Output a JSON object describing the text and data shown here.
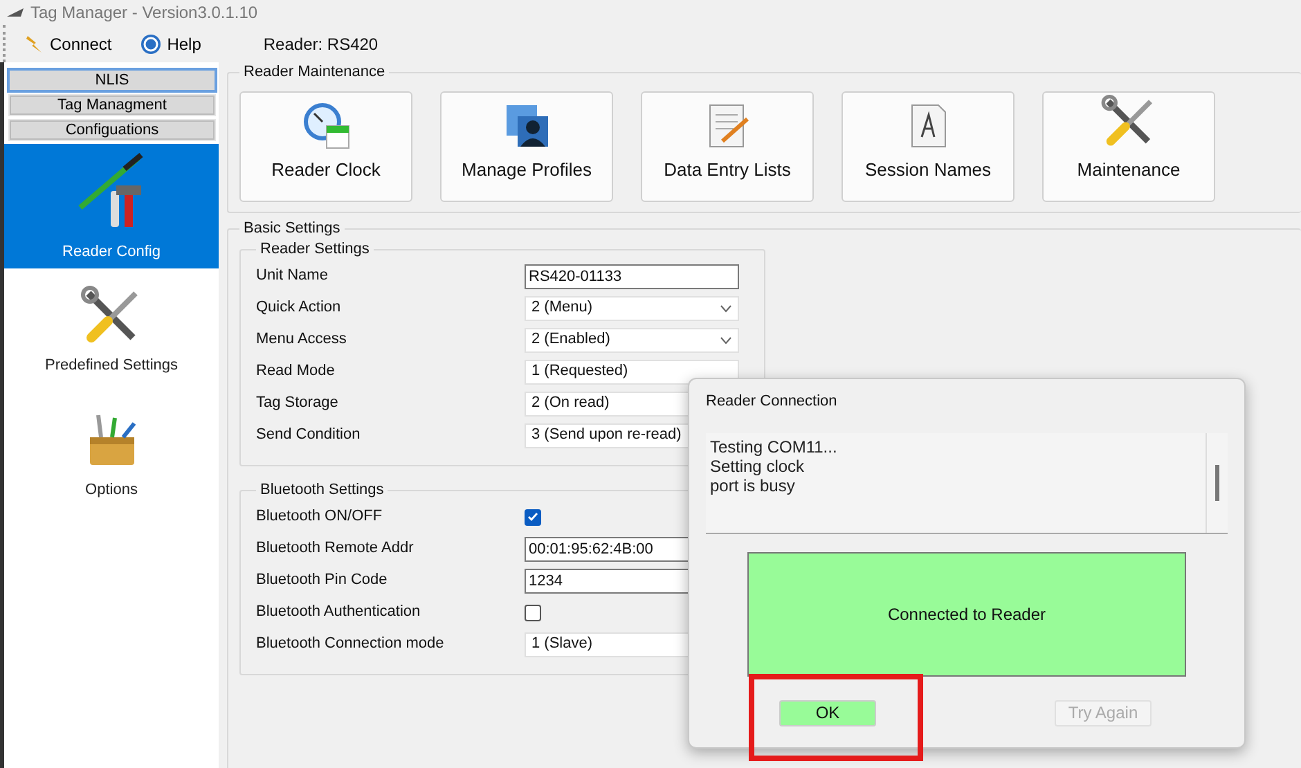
{
  "window": {
    "title": "Tag Manager - Version3.0.1.10"
  },
  "toolbar": {
    "buttons": [
      {
        "label": "Connect",
        "kind": "connect"
      },
      {
        "label": "Help",
        "kind": "help"
      }
    ],
    "reader": "Reader: RS420"
  },
  "sidebar": {
    "sections": [
      {
        "label": "NLIS",
        "selected": true
      },
      {
        "label": "Tag Managment",
        "selected": false
      },
      {
        "label": "Configuations",
        "selected": false
      }
    ],
    "items": [
      {
        "label": "Reader Config",
        "kind": "config",
        "selected": true
      },
      {
        "label": "Predefined Settings",
        "kind": "tools",
        "selected": false
      },
      {
        "label": "Options",
        "kind": "toolbox",
        "selected": false
      }
    ]
  },
  "maintenance": {
    "title": "Reader Maintenance",
    "buttons": [
      {
        "label": "Reader Clock",
        "kind": "clock"
      },
      {
        "label": "Manage Profiles",
        "kind": "profiles"
      },
      {
        "label": "Data Entry Lists",
        "kind": "notepad"
      },
      {
        "label": "Session Names",
        "kind": "document"
      },
      {
        "label": "Maintenance",
        "kind": "tools"
      }
    ]
  },
  "basic_settings": {
    "title": "Basic Settings",
    "groups": [
      {
        "title": "Reader Settings",
        "fields": [
          {
            "label": "Unit Name",
            "kind": "text",
            "value": "RS420-01133"
          },
          {
            "label": "Quick Action",
            "kind": "select",
            "value": "2 (Menu)",
            "arrow": true
          },
          {
            "label": "Menu Access",
            "kind": "select",
            "value": "2 (Enabled)",
            "arrow": true
          },
          {
            "label": "Read Mode",
            "kind": "select",
            "value": "1 (Requested)"
          },
          {
            "label": "Tag Storage",
            "kind": "select",
            "value": "2 (On read)"
          },
          {
            "label": "Send Condition",
            "kind": "select",
            "value": "3 (Send upon re-read)"
          }
        ]
      },
      {
        "title": "Bluetooth Settings",
        "fields": [
          {
            "label": "Bluetooth ON/OFF",
            "kind": "checkbox",
            "checked": true
          },
          {
            "label": "Bluetooth Remote Addr",
            "kind": "text",
            "value": "00:01:95:62:4B:00"
          },
          {
            "label": "Bluetooth Pin Code",
            "kind": "text",
            "value": "1234"
          },
          {
            "label": "Bluetooth Authentication",
            "kind": "checkbox",
            "checked": false
          },
          {
            "label": "Bluetooth Connection mode",
            "kind": "select",
            "value": "1 (Slave)"
          }
        ]
      }
    ]
  },
  "dialog": {
    "title": "Reader Connection",
    "log": [
      "Testing COM11...",
      "Setting clock",
      "port is busy"
    ],
    "status": "Connected to Reader",
    "buttons": [
      {
        "label": "OK",
        "disabled": false,
        "highlighted": true
      },
      {
        "label": "Try Again",
        "disabled": true,
        "highlighted": false
      }
    ]
  }
}
